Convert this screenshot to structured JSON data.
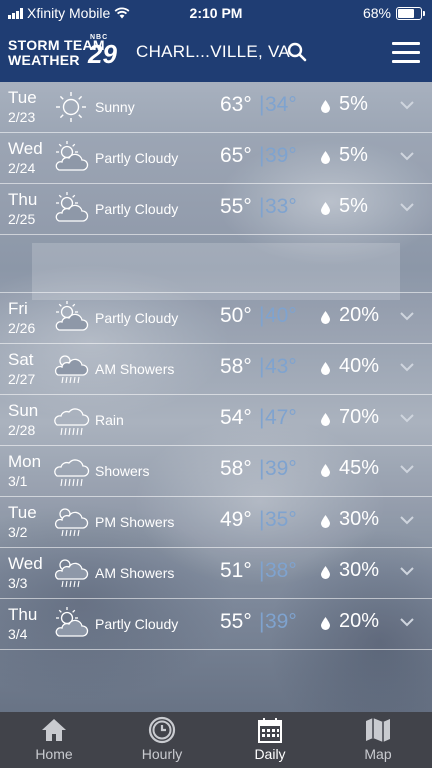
{
  "status_bar": {
    "carrier": "Xfinity Mobile",
    "time": "2:10 PM",
    "battery": "68%"
  },
  "header": {
    "logo_line1": "STORM TEAM",
    "logo_line2": "WEATHER",
    "logo_number": "29",
    "logo_network": "NBC",
    "location": "CHARL...VILLE, VA"
  },
  "forecast": [
    {
      "day": "Tue",
      "date": "2/23",
      "icon": "sunny-icon",
      "condition": "Sunny",
      "high": "63°",
      "low": "34°",
      "precip": "5%"
    },
    {
      "day": "Wed",
      "date": "2/24",
      "icon": "partly-cloudy-icon",
      "condition": "Partly Cloudy",
      "high": "65°",
      "low": "39°",
      "precip": "5%"
    },
    {
      "day": "Thu",
      "date": "2/25",
      "icon": "partly-cloudy-icon",
      "condition": "Partly Cloudy",
      "high": "55°",
      "low": "33°",
      "precip": "5%"
    },
    {
      "day": "Fri",
      "date": "2/26",
      "icon": "partly-cloudy-icon",
      "condition": "Partly Cloudy",
      "high": "50°",
      "low": "40°",
      "precip": "20%"
    },
    {
      "day": "Sat",
      "date": "2/27",
      "icon": "showers-icon",
      "condition": "AM Showers",
      "high": "58°",
      "low": "43°",
      "precip": "40%"
    },
    {
      "day": "Sun",
      "date": "2/28",
      "icon": "rain-icon",
      "condition": "Rain",
      "high": "54°",
      "low": "47°",
      "precip": "70%"
    },
    {
      "day": "Mon",
      "date": "3/1",
      "icon": "rain-icon",
      "condition": "Showers",
      "high": "58°",
      "low": "39°",
      "precip": "45%"
    },
    {
      "day": "Tue",
      "date": "3/2",
      "icon": "showers-icon",
      "condition": "PM Showers",
      "high": "49°",
      "low": "35°",
      "precip": "30%"
    },
    {
      "day": "Wed",
      "date": "3/3",
      "icon": "showers-icon",
      "condition": "AM Showers",
      "high": "51°",
      "low": "38°",
      "precip": "30%"
    },
    {
      "day": "Thu",
      "date": "3/4",
      "icon": "partly-cloudy-icon",
      "condition": "Partly Cloudy",
      "high": "55°",
      "low": "39°",
      "precip": "20%"
    }
  ],
  "tabs": [
    {
      "label": "Home",
      "icon": "home-icon"
    },
    {
      "label": "Hourly",
      "icon": "clock-icon"
    },
    {
      "label": "Daily",
      "icon": "calendar-icon",
      "active": true
    },
    {
      "label": "Map",
      "icon": "map-icon"
    }
  ],
  "colors": {
    "header": "#1f3d73",
    "low_temp": "#7fa3cf",
    "tabbar": "#41434a"
  }
}
